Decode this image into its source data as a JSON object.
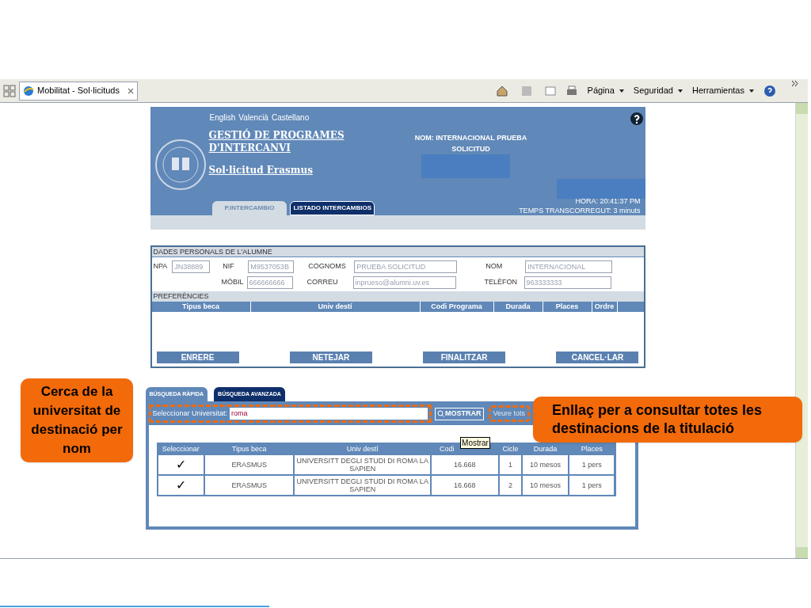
{
  "browser": {
    "tab_title": "Mobilitat - Sol·licituds",
    "menus": [
      "Página",
      "Seguridad",
      "Herramientas"
    ]
  },
  "header": {
    "languages": [
      "English",
      "Valencià",
      "Castellano"
    ],
    "title_line_1": "GESTIÓ DE PROGRAMES",
    "title_line_2": "D'INTERCANVI",
    "subtitle": "Sol·licitud Erasmus",
    "user_line_1": "NOM: INTERNACIONAL PRUEBA",
    "user_line_2": "SOLICITUD",
    "time": "HORA: 20:41:37 PM",
    "elapsed": "TEMPS TRANSCORREGUT: 3 minuts",
    "tabs": [
      {
        "label": "P.INTERCAMBIO",
        "selected": true
      },
      {
        "label": "LISTADO INTERCAMBIOS",
        "selected": false
      }
    ]
  },
  "personal": {
    "title": "DADES PERSONALS DE L'ALUMNE",
    "npa_label": "NPA",
    "npa": "JN38889",
    "nif_label": "NIF",
    "nif": "M9537053B",
    "surname_label": "COGNOMS",
    "surname": "PRUEBA SOLICITUD",
    "name_label": "NOM",
    "name": "INTERNACIONAL",
    "mobile_label": "MÒBIL",
    "mobile": "666666666",
    "email_label": "CORREU",
    "email": "inprueso@alumni.uv.es",
    "phone_label": "TELÈFON",
    "phone": "963333333"
  },
  "preferences": {
    "title": "PREFERÈNCIES",
    "columns": [
      "Tipus beca",
      "Univ destí",
      "Codi Programa",
      "Durada",
      "Places",
      "Ordre"
    ]
  },
  "actions": [
    "ENRERE",
    "NETEJAR",
    "FINALITZAR",
    "CANCEL·LAR"
  ],
  "search": {
    "tabs": [
      {
        "label": "BÚSQUEDA RÀPIDA",
        "selected": true
      },
      {
        "label": "BÚSQUEDA AVANZADA",
        "selected": false
      }
    ],
    "label": "Seleccionar Universitat:",
    "value": "roma",
    "button": "MOSTRAR",
    "link": "Veure tots",
    "tooltip": "Mostrar"
  },
  "results": {
    "columns": [
      "Seleccionar",
      "Tipus beca",
      "Univ destí",
      "Codi",
      "Cicle",
      "Durada",
      "Places"
    ],
    "rows": [
      {
        "select": "✓",
        "type": "ERASMUS",
        "univ": "UNIVERSITT DEGLI STUDI DI ROMA LA SAPIEN",
        "code": "16.668",
        "cycle": "1",
        "duration": "10 mesos",
        "places": "1 pers"
      },
      {
        "select": "✓",
        "type": "ERASMUS",
        "univ": "UNIVERSITT DEGLI STUDI DI ROMA LA SAPIEN",
        "code": "16.668",
        "cycle": "2",
        "duration": "10 mesos",
        "places": "1 pers"
      }
    ]
  },
  "callouts": [
    "Cerca de la universitat de destinació per nom",
    "Enllaç per a consultar totes les destinacions de la titulació"
  ]
}
